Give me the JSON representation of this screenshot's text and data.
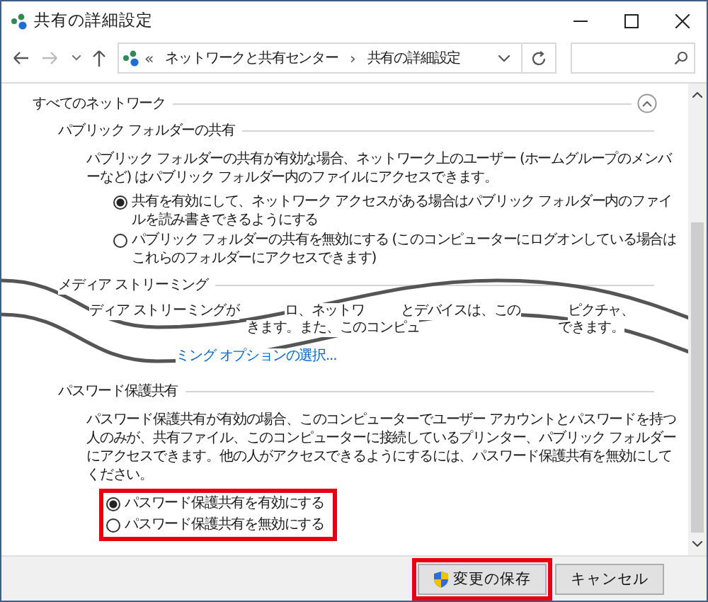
{
  "window": {
    "title": "共有の詳細設定"
  },
  "address_bar": {
    "overflow": "«",
    "separator": "›",
    "breadcrumbs": [
      "ネットワークと共有センター",
      "共有の詳細設定"
    ]
  },
  "sections": [
    {
      "heading": "すべてのネットワーク",
      "expanded": true,
      "groups": [
        {
          "kind": "options",
          "heading": "パブリック フォルダーの共有",
          "description": "パブリック フォルダーの共有が有効な場合、ネットワーク上のユーザー (ホームグループのメンバーなど) はパブリック フォルダー内のファイルにアクセスできます。",
          "options": [
            {
              "label": "共有を有効にして、ネットワーク アクセスがある場合はパブリック フォルダー内のファイルを読み書きできるようにする",
              "selected": true
            },
            {
              "label": "パブリック フォルダーの共有を無効にする (このコンピューターにログオンしている場合はこれらのフォルダーにアクセスできます)",
              "selected": false
            }
          ]
        },
        {
          "kind": "cut",
          "heading": "メディア ストリーミング",
          "fragments": [
            [
              "ディア ストリーミングが",
              "ロ、ネットワ",
              "とデバイスは、この",
              "ピクチャ、"
            ],
            [
              "きます。また、このコンピュ",
              "できます。"
            ]
          ],
          "link": "ミング オプションの選択..."
        },
        {
          "kind": "options",
          "heading": "パスワード保護共有",
          "description": "パスワード保護共有が有効の場合、このコンピューターでユーザー アカウントとパスワードを持つ人のみが、共有ファイル、このコンピューターに接続しているプリンター、パブリック フォルダーにアクセスできます。他の人がアクセスできるようにするには、パスワード保護共有を無効にしてください。",
          "highlighted": true,
          "options": [
            {
              "label": "パスワード保護共有を有効にする",
              "selected": true
            },
            {
              "label": "パスワード保護共有を無効にする",
              "selected": false
            }
          ]
        }
      ]
    }
  ],
  "buttons": [
    {
      "label": "変更の保存",
      "kind": "admin",
      "highlighted": true
    },
    {
      "label": "キャンセル",
      "kind": "plain"
    }
  ]
}
